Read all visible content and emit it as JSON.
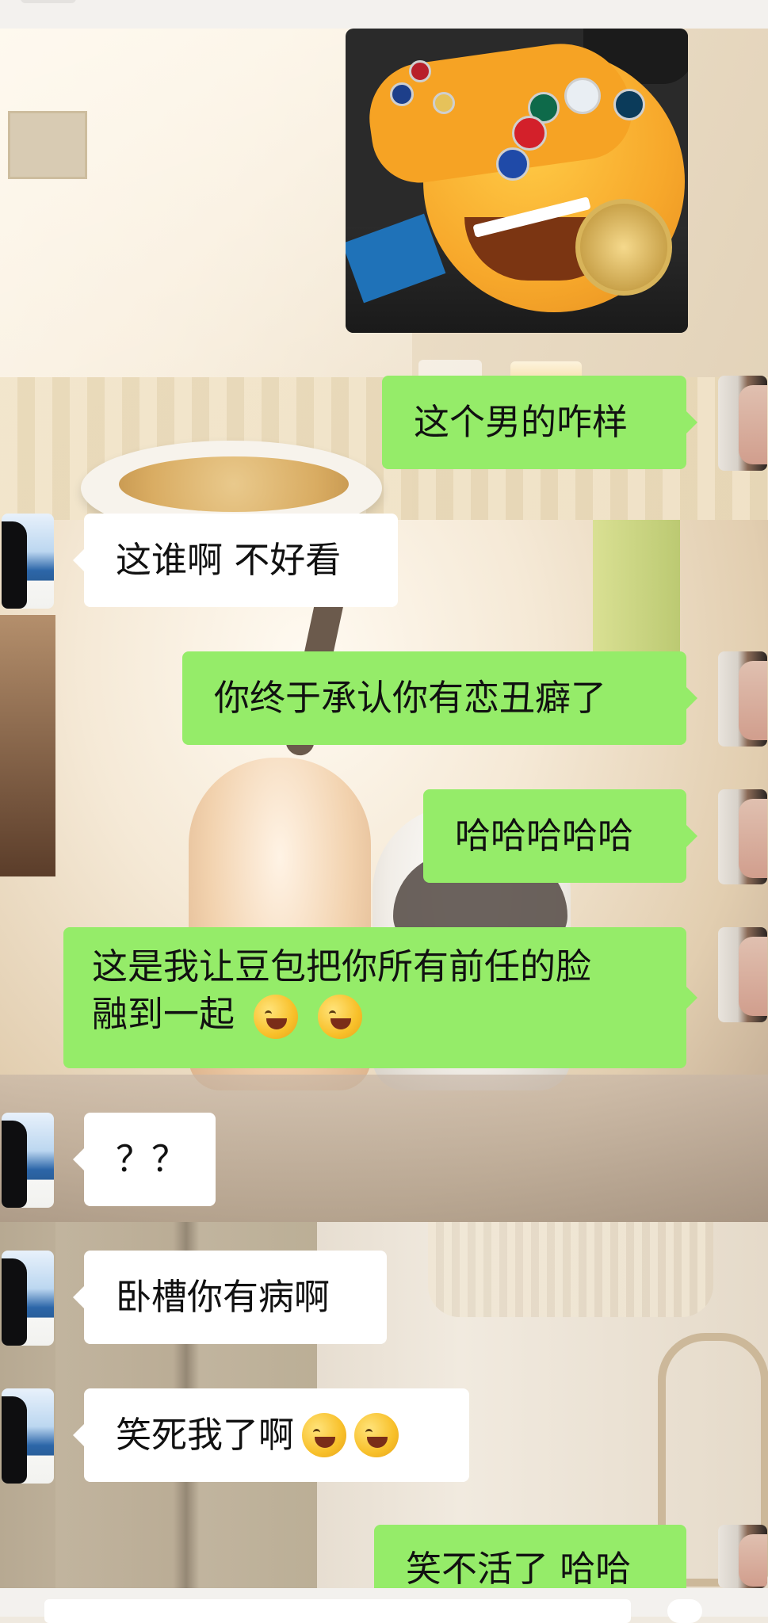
{
  "chat": {
    "sticker": {
      "alt": "sticker-image"
    },
    "messages": [
      {
        "from": "self",
        "text": "这个男的咋样"
      },
      {
        "from": "friend",
        "text": "这谁啊 不好看"
      },
      {
        "from": "self",
        "text": "你终于承认你有恋丑癖了"
      },
      {
        "from": "self",
        "text": "哈哈哈哈哈"
      },
      {
        "from": "self",
        "line1": "这是我让豆包把你所有前任的脸",
        "line2": "融到一起",
        "emoji": "rofl-emoji"
      },
      {
        "from": "friend",
        "text": "？？"
      },
      {
        "from": "friend",
        "text": "卧槽你有病啊"
      },
      {
        "from": "friend",
        "text": "笑死我了啊",
        "emoji": "joy-emoji"
      },
      {
        "from": "self",
        "text": "笑不活了 哈哈"
      }
    ]
  },
  "colors": {
    "self_bubble": "#95ec69",
    "friend_bubble": "#ffffff"
  }
}
